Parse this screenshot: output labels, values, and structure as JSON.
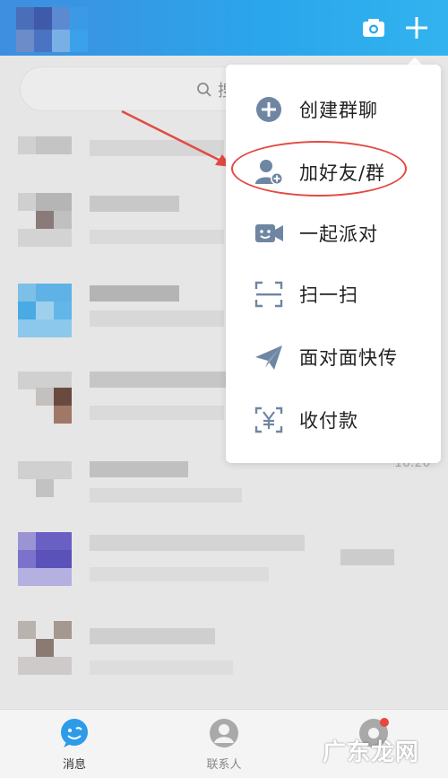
{
  "header": {
    "camera_icon": "camera-icon",
    "add_icon": "plus-icon"
  },
  "search": {
    "placeholder_fragment": "搜"
  },
  "menu": {
    "items": [
      {
        "label": "创建群聊",
        "icon": "add-circle-icon"
      },
      {
        "label": "加好友/群",
        "icon": "add-friend-icon"
      },
      {
        "label": "一起派对",
        "icon": "party-video-icon"
      },
      {
        "label": "扫一扫",
        "icon": "scan-icon"
      },
      {
        "label": "面对面快传",
        "icon": "paper-plane-icon"
      },
      {
        "label": "收付款",
        "icon": "yuan-scan-icon"
      }
    ]
  },
  "list": {
    "time_fragment": "16:20"
  },
  "tabs": [
    {
      "label": "消息",
      "icon": "message-icon",
      "active": true
    },
    {
      "label": "联系人",
      "icon": "contacts-icon",
      "active": false
    },
    {
      "label": "",
      "icon": "dynamic-icon",
      "active": false
    }
  ],
  "watermark": "广东龙网",
  "colors": {
    "header_start": "#3f8ee0",
    "header_end": "#32b3ee",
    "highlight": "#e24a43",
    "active_tab": "#2e9be8",
    "menu_icon": "#6f86a3"
  }
}
